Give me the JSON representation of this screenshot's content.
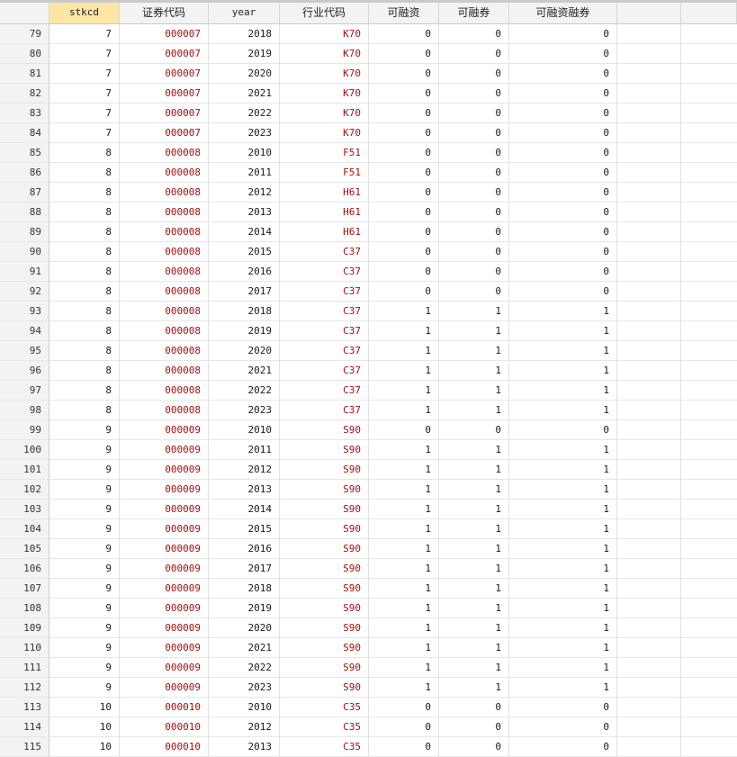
{
  "columns": [
    "stkcd",
    "证券代码",
    "year",
    "行业代码",
    "可融资",
    "可融券",
    "可融资融券"
  ],
  "selected_column": "stkcd",
  "colors": {
    "string_text": "#a01010",
    "header_selected": "#fbe6a6"
  },
  "rows": [
    {
      "n": "79",
      "stkcd": "7",
      "code": "000007",
      "year": "2018",
      "ind": "K70",
      "a": "0",
      "b": "0",
      "c": "0"
    },
    {
      "n": "80",
      "stkcd": "7",
      "code": "000007",
      "year": "2019",
      "ind": "K70",
      "a": "0",
      "b": "0",
      "c": "0"
    },
    {
      "n": "81",
      "stkcd": "7",
      "code": "000007",
      "year": "2020",
      "ind": "K70",
      "a": "0",
      "b": "0",
      "c": "0"
    },
    {
      "n": "82",
      "stkcd": "7",
      "code": "000007",
      "year": "2021",
      "ind": "K70",
      "a": "0",
      "b": "0",
      "c": "0"
    },
    {
      "n": "83",
      "stkcd": "7",
      "code": "000007",
      "year": "2022",
      "ind": "K70",
      "a": "0",
      "b": "0",
      "c": "0"
    },
    {
      "n": "84",
      "stkcd": "7",
      "code": "000007",
      "year": "2023",
      "ind": "K70",
      "a": "0",
      "b": "0",
      "c": "0"
    },
    {
      "n": "85",
      "stkcd": "8",
      "code": "000008",
      "year": "2010",
      "ind": "F51",
      "a": "0",
      "b": "0",
      "c": "0"
    },
    {
      "n": "86",
      "stkcd": "8",
      "code": "000008",
      "year": "2011",
      "ind": "F51",
      "a": "0",
      "b": "0",
      "c": "0"
    },
    {
      "n": "87",
      "stkcd": "8",
      "code": "000008",
      "year": "2012",
      "ind": "H61",
      "a": "0",
      "b": "0",
      "c": "0"
    },
    {
      "n": "88",
      "stkcd": "8",
      "code": "000008",
      "year": "2013",
      "ind": "H61",
      "a": "0",
      "b": "0",
      "c": "0"
    },
    {
      "n": "89",
      "stkcd": "8",
      "code": "000008",
      "year": "2014",
      "ind": "H61",
      "a": "0",
      "b": "0",
      "c": "0"
    },
    {
      "n": "90",
      "stkcd": "8",
      "code": "000008",
      "year": "2015",
      "ind": "C37",
      "a": "0",
      "b": "0",
      "c": "0"
    },
    {
      "n": "91",
      "stkcd": "8",
      "code": "000008",
      "year": "2016",
      "ind": "C37",
      "a": "0",
      "b": "0",
      "c": "0"
    },
    {
      "n": "92",
      "stkcd": "8",
      "code": "000008",
      "year": "2017",
      "ind": "C37",
      "a": "0",
      "b": "0",
      "c": "0"
    },
    {
      "n": "93",
      "stkcd": "8",
      "code": "000008",
      "year": "2018",
      "ind": "C37",
      "a": "1",
      "b": "1",
      "c": "1"
    },
    {
      "n": "94",
      "stkcd": "8",
      "code": "000008",
      "year": "2019",
      "ind": "C37",
      "a": "1",
      "b": "1",
      "c": "1"
    },
    {
      "n": "95",
      "stkcd": "8",
      "code": "000008",
      "year": "2020",
      "ind": "C37",
      "a": "1",
      "b": "1",
      "c": "1"
    },
    {
      "n": "96",
      "stkcd": "8",
      "code": "000008",
      "year": "2021",
      "ind": "C37",
      "a": "1",
      "b": "1",
      "c": "1"
    },
    {
      "n": "97",
      "stkcd": "8",
      "code": "000008",
      "year": "2022",
      "ind": "C37",
      "a": "1",
      "b": "1",
      "c": "1"
    },
    {
      "n": "98",
      "stkcd": "8",
      "code": "000008",
      "year": "2023",
      "ind": "C37",
      "a": "1",
      "b": "1",
      "c": "1"
    },
    {
      "n": "99",
      "stkcd": "9",
      "code": "000009",
      "year": "2010",
      "ind": "S90",
      "a": "0",
      "b": "0",
      "c": "0"
    },
    {
      "n": "100",
      "stkcd": "9",
      "code": "000009",
      "year": "2011",
      "ind": "S90",
      "a": "1",
      "b": "1",
      "c": "1"
    },
    {
      "n": "101",
      "stkcd": "9",
      "code": "000009",
      "year": "2012",
      "ind": "S90",
      "a": "1",
      "b": "1",
      "c": "1"
    },
    {
      "n": "102",
      "stkcd": "9",
      "code": "000009",
      "year": "2013",
      "ind": "S90",
      "a": "1",
      "b": "1",
      "c": "1"
    },
    {
      "n": "103",
      "stkcd": "9",
      "code": "000009",
      "year": "2014",
      "ind": "S90",
      "a": "1",
      "b": "1",
      "c": "1"
    },
    {
      "n": "104",
      "stkcd": "9",
      "code": "000009",
      "year": "2015",
      "ind": "S90",
      "a": "1",
      "b": "1",
      "c": "1"
    },
    {
      "n": "105",
      "stkcd": "9",
      "code": "000009",
      "year": "2016",
      "ind": "S90",
      "a": "1",
      "b": "1",
      "c": "1"
    },
    {
      "n": "106",
      "stkcd": "9",
      "code": "000009",
      "year": "2017",
      "ind": "S90",
      "a": "1",
      "b": "1",
      "c": "1"
    },
    {
      "n": "107",
      "stkcd": "9",
      "code": "000009",
      "year": "2018",
      "ind": "S90",
      "a": "1",
      "b": "1",
      "c": "1"
    },
    {
      "n": "108",
      "stkcd": "9",
      "code": "000009",
      "year": "2019",
      "ind": "S90",
      "a": "1",
      "b": "1",
      "c": "1"
    },
    {
      "n": "109",
      "stkcd": "9",
      "code": "000009",
      "year": "2020",
      "ind": "S90",
      "a": "1",
      "b": "1",
      "c": "1"
    },
    {
      "n": "110",
      "stkcd": "9",
      "code": "000009",
      "year": "2021",
      "ind": "S90",
      "a": "1",
      "b": "1",
      "c": "1"
    },
    {
      "n": "111",
      "stkcd": "9",
      "code": "000009",
      "year": "2022",
      "ind": "S90",
      "a": "1",
      "b": "1",
      "c": "1"
    },
    {
      "n": "112",
      "stkcd": "9",
      "code": "000009",
      "year": "2023",
      "ind": "S90",
      "a": "1",
      "b": "1",
      "c": "1"
    },
    {
      "n": "113",
      "stkcd": "10",
      "code": "000010",
      "year": "2010",
      "ind": "C35",
      "a": "0",
      "b": "0",
      "c": "0"
    },
    {
      "n": "114",
      "stkcd": "10",
      "code": "000010",
      "year": "2012",
      "ind": "C35",
      "a": "0",
      "b": "0",
      "c": "0"
    },
    {
      "n": "115",
      "stkcd": "10",
      "code": "000010",
      "year": "2013",
      "ind": "C35",
      "a": "0",
      "b": "0",
      "c": "0"
    }
  ]
}
